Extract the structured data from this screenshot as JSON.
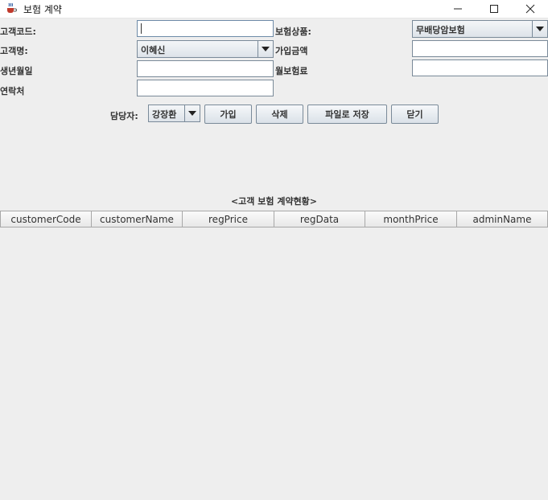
{
  "window": {
    "title": "보험 계약",
    "app_icon": "java-cup-icon",
    "controls": {
      "minimize": "—",
      "maximize": "☐",
      "close": "✕"
    }
  },
  "form": {
    "customer_code": {
      "label": "고객코드:",
      "value": ""
    },
    "customer_name": {
      "label": "고객명:",
      "value": "이혜신"
    },
    "birth_date": {
      "label": "생년월일",
      "value": ""
    },
    "contact": {
      "label": "연락처",
      "value": ""
    },
    "insurance_product": {
      "label": "보험상품:",
      "value": "무배당암보험"
    },
    "join_amount": {
      "label": "가입금액",
      "value": ""
    },
    "monthly_premium": {
      "label": "월보험료",
      "value": ""
    }
  },
  "actions": {
    "manager_label": "담당자:",
    "manager_value": "강장환",
    "join": "가입",
    "delete": "삭제",
    "save_to_file": "파일로 저장",
    "close": "닫기"
  },
  "table": {
    "title": "<고객 보험 계약현황>",
    "columns": [
      "customerCode",
      "customerName",
      "regPrice",
      "regData",
      "monthPrice",
      "adminName"
    ],
    "rows": []
  }
}
